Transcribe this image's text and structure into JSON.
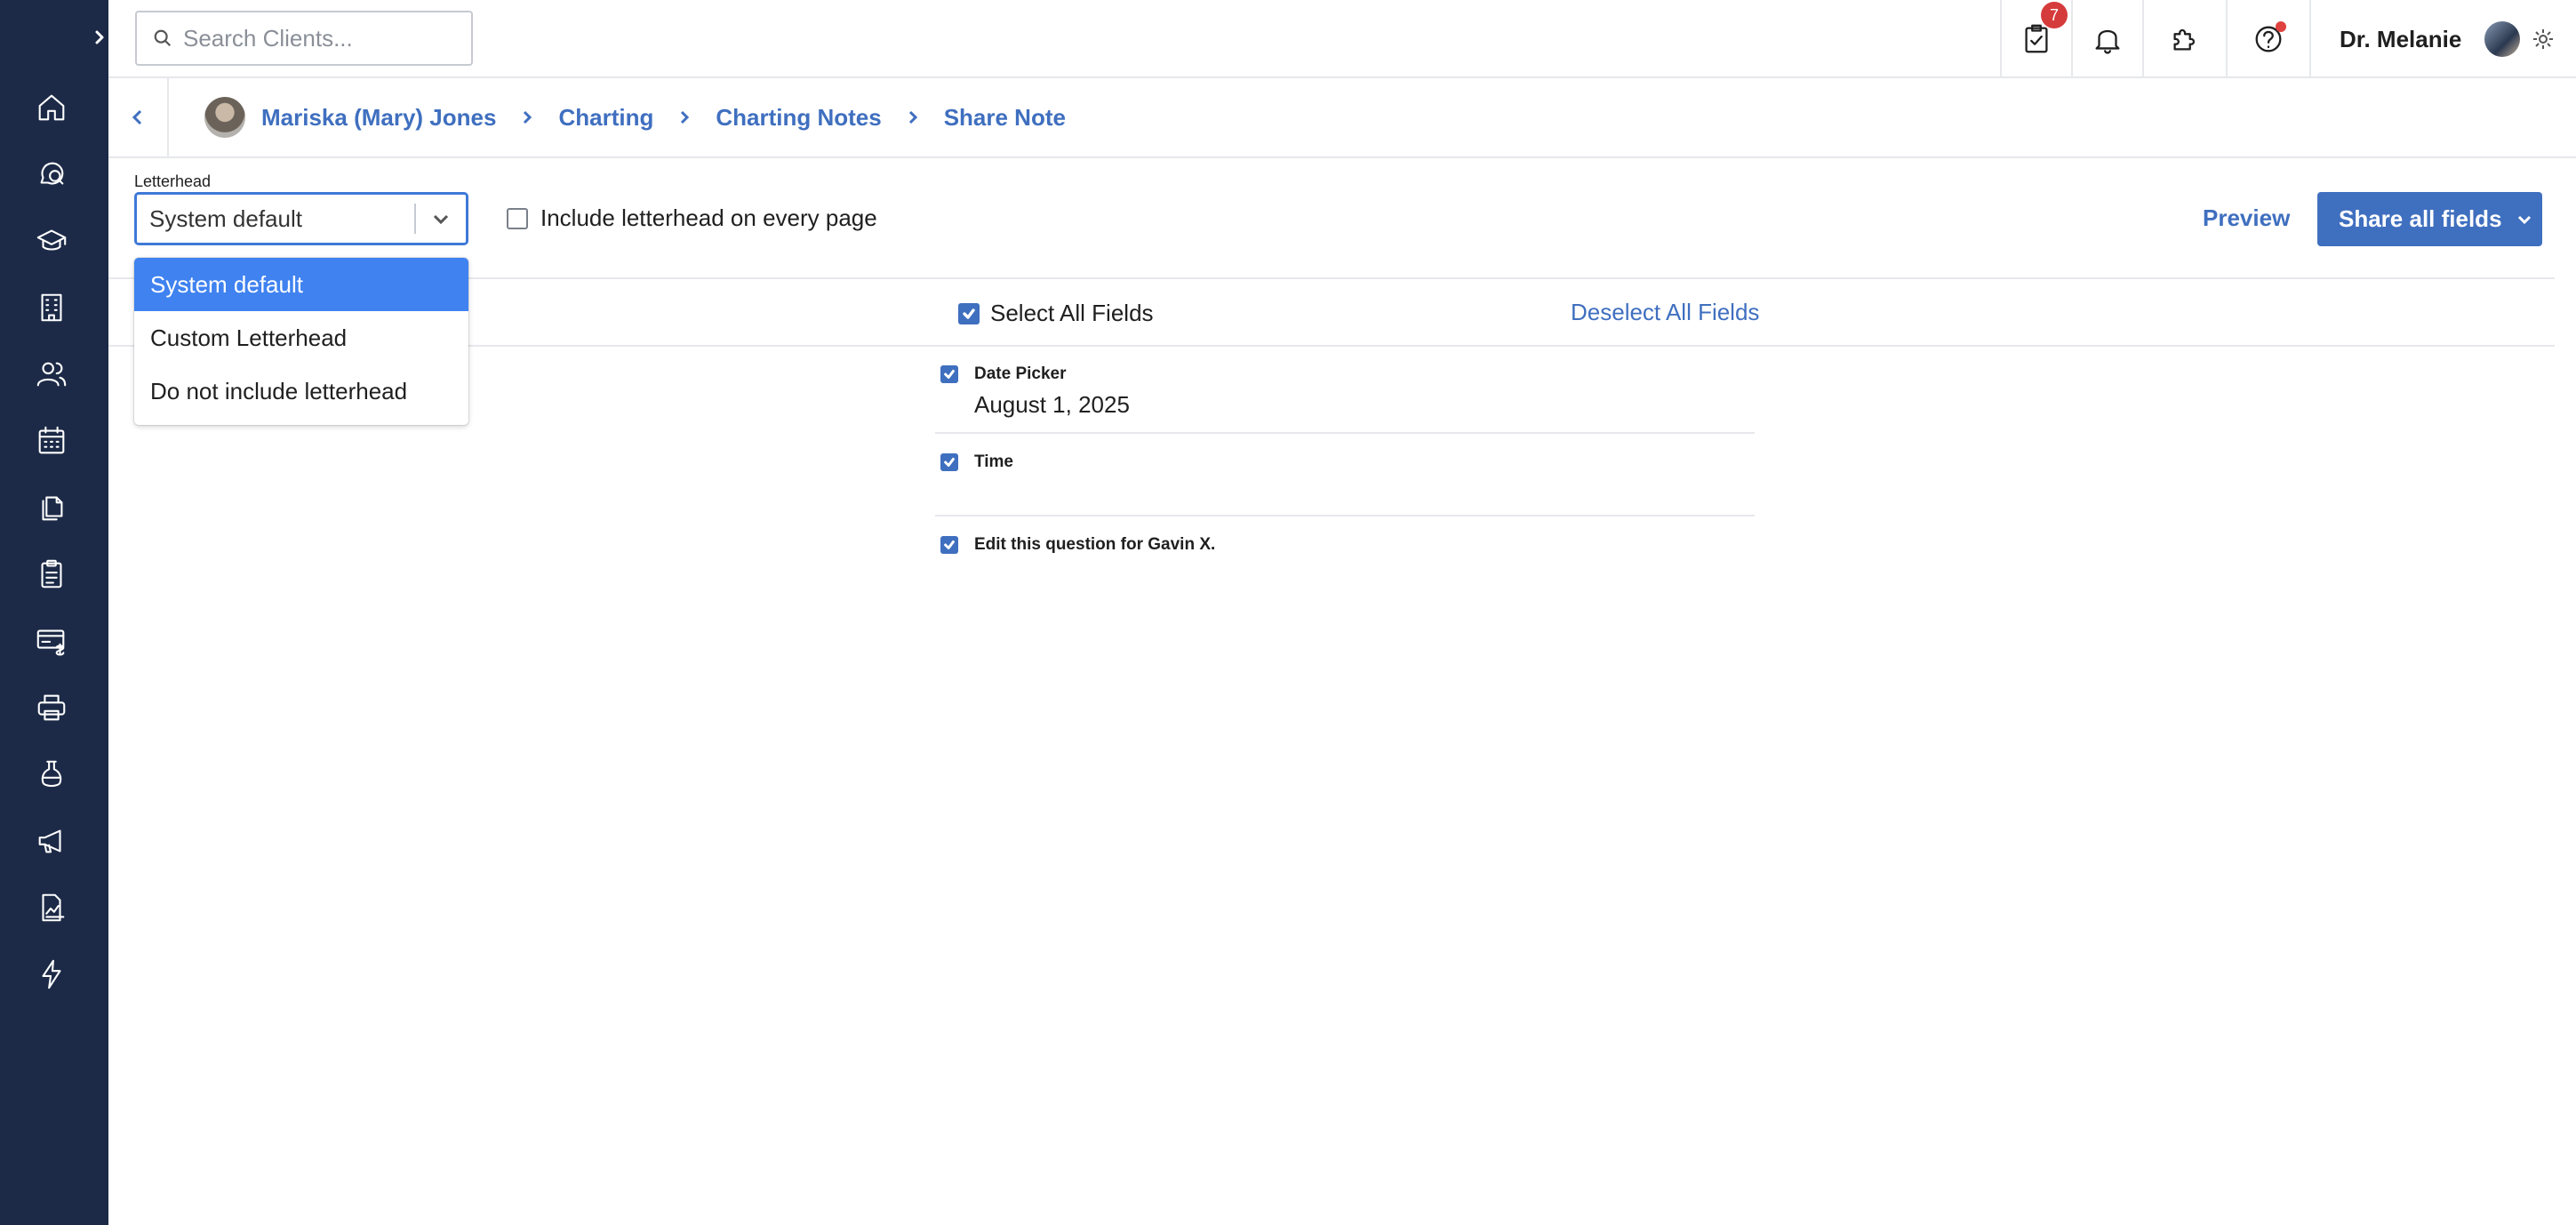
{
  "search": {
    "placeholder": "Search Clients..."
  },
  "header": {
    "tasks_badge": "7",
    "user_name": "Dr. Melanie"
  },
  "breadcrumb": {
    "items": [
      {
        "label": "Mariska (Mary) Jones"
      },
      {
        "label": "Charting"
      },
      {
        "label": "Charting Notes"
      },
      {
        "label": "Share Note"
      }
    ]
  },
  "letterhead": {
    "label": "Letterhead",
    "selected": "System default",
    "options": [
      "System default",
      "Custom Letterhead",
      "Do not include letterhead"
    ],
    "every_page_label": "Include letterhead on every page",
    "every_page_checked": false
  },
  "actions": {
    "preview_label": "Preview",
    "share_label": "Share all fields"
  },
  "fields": {
    "select_all_label": "Select All Fields",
    "deselect_all_label": "Deselect All Fields",
    "items": [
      {
        "label": "Date Picker",
        "value": "August 1, 2025",
        "checked": true
      },
      {
        "label": "Time",
        "value": "",
        "checked": true
      },
      {
        "label": "Edit this question for Gavin X.",
        "value": "",
        "checked": true
      }
    ]
  },
  "colors": {
    "sidebar_bg": "#1c2a47",
    "accent": "#3f6fbf",
    "dropdown_selected": "#3f82f0",
    "badge": "#d63b3b"
  },
  "sidebar": {
    "icons": [
      "home-icon",
      "search-chat-icon",
      "graduation-cap-icon",
      "building-icon",
      "users-icon",
      "calendar-icon",
      "documents-icon",
      "clipboard-icon",
      "billing-icon",
      "printer-icon",
      "flask-icon",
      "megaphone-icon",
      "report-icon",
      "lightning-icon"
    ]
  }
}
